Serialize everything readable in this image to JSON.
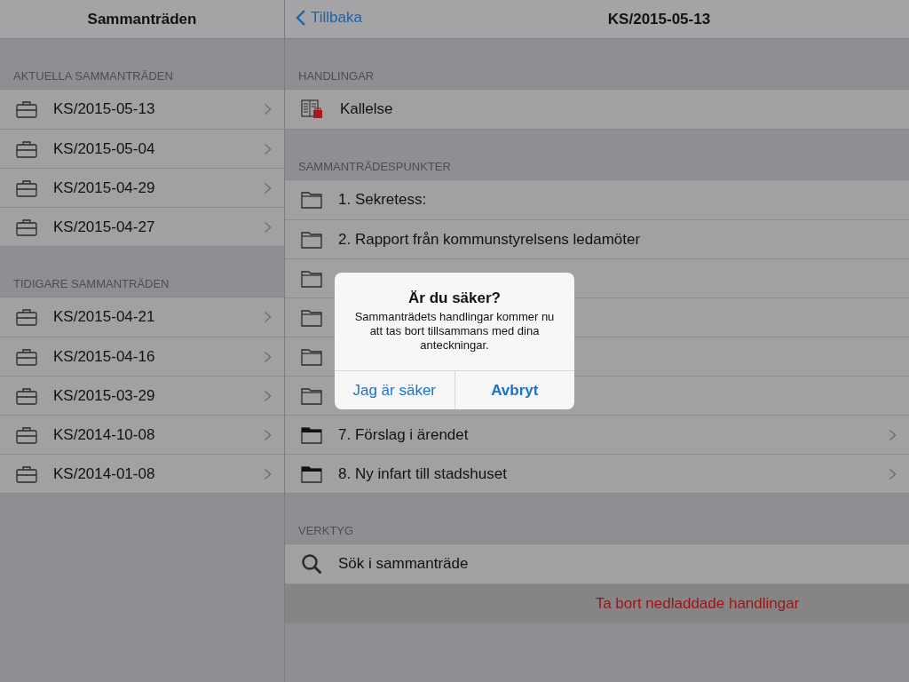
{
  "master": {
    "title": "Sammanträden",
    "sections": [
      {
        "header": "AKTUELLA SAMMANTRÄDEN",
        "items": [
          "KS/2015-05-13",
          "KS/2015-05-04",
          "KS/2015-04-29",
          "KS/2015-04-27"
        ]
      },
      {
        "header": "TIDIGARE SAMMANTRÄDEN",
        "items": [
          "KS/2015-04-21",
          "KS/2015-04-16",
          "KS/2015-03-29",
          "KS/2014-10-08",
          "KS/2014-01-08"
        ]
      }
    ]
  },
  "detail": {
    "back": "Tillbaka",
    "title": "KS/2015-05-13",
    "sections": [
      {
        "header": "HANDLINGAR",
        "rows": [
          {
            "kind": "document",
            "label": "Kallelse"
          }
        ]
      },
      {
        "header": "SAMMANTRÄDESPUNKTER",
        "rows": [
          {
            "kind": "folder",
            "label": "1. Sekretess:",
            "has_items": false
          },
          {
            "kind": "folder",
            "label": "2. Rapport från kommunstyrelsens ledamöter",
            "has_items": false
          },
          {
            "kind": "folder",
            "has_items": false
          },
          {
            "kind": "folder",
            "has_items": false
          },
          {
            "kind": "folder",
            "has_items": false
          },
          {
            "kind": "folder",
            "has_items": false
          },
          {
            "kind": "folder",
            "label": "7. Förslag i ärendet",
            "has_items": true
          },
          {
            "kind": "folder",
            "label": "8. Ny infart till stadshuset",
            "has_items": true
          }
        ]
      },
      {
        "header": "VERKTYG",
        "rows": [
          {
            "kind": "search",
            "label": "Sök i sammanträde"
          },
          {
            "kind": "destructive",
            "label": "Ta bort nedladdade handlingar"
          }
        ]
      }
    ]
  },
  "alert": {
    "title": "Är du säker?",
    "message": "Sammanträdets handlingar kommer nu att tas bort tillsammans med dina anteckningar.",
    "buttons": [
      {
        "label": "Jag är säker",
        "bold": false
      },
      {
        "label": "Avbryt",
        "bold": true
      }
    ]
  }
}
